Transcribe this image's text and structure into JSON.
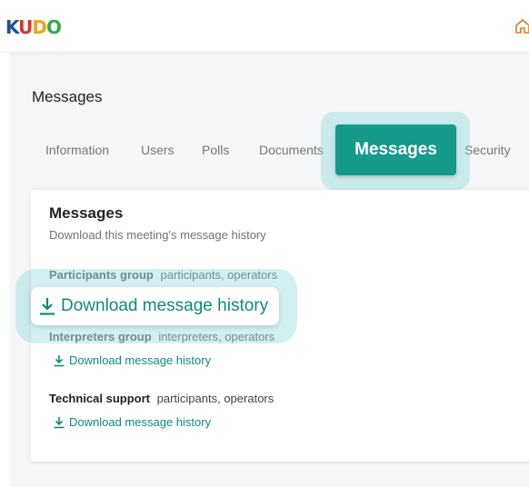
{
  "header": {
    "logo_letters": [
      "K",
      "U",
      "D",
      "O"
    ],
    "home_icon": "home-icon"
  },
  "page": {
    "title": "Messages"
  },
  "tabs": [
    {
      "label": "Information",
      "active": false
    },
    {
      "label": "Users",
      "active": false
    },
    {
      "label": "Polls",
      "active": false
    },
    {
      "label": "Documents",
      "active": false
    },
    {
      "label": "Messages",
      "active": true
    },
    {
      "label": "Security",
      "active": false
    }
  ],
  "card": {
    "title": "Messages",
    "subtitle": "Download this meeting's message history",
    "groups": [
      {
        "name": "Participants group",
        "roles": "participants, operators",
        "link": "Download message history"
      },
      {
        "name": "Interpreters group",
        "roles": "interpreters, operators",
        "link": "Download message history"
      },
      {
        "name": "Technical support",
        "roles": "participants, operators",
        "link": "Download message history"
      }
    ]
  },
  "colors": {
    "accent": "#169a8a",
    "link": "#0f8a7c",
    "highlight": "#7fd4d6"
  }
}
